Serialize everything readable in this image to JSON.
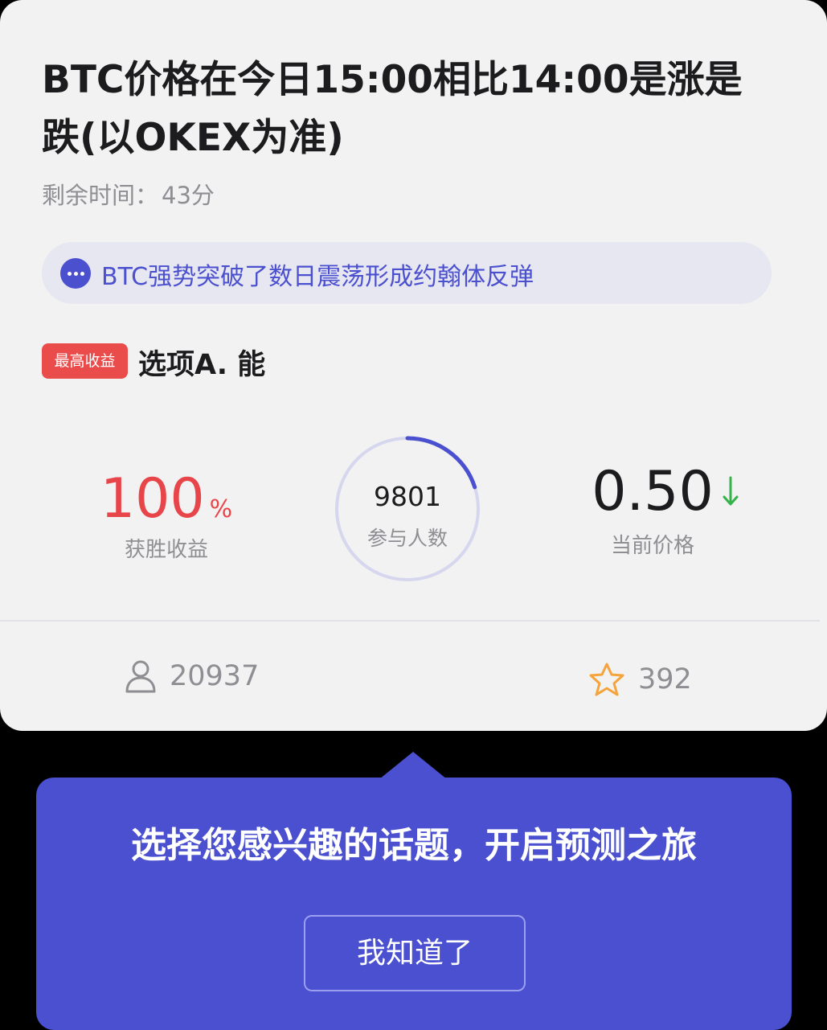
{
  "card": {
    "title": "BTC价格在今日15:00相比14:00是涨是跌(以OKEX为准)",
    "remaining_label": "剩余时间：",
    "remaining_value": "43分",
    "news_text": "BTC强势突破了数日震荡形成约翰体反弹",
    "badge": "最高收益",
    "option": "选项A. 能",
    "payout_value": "100",
    "payout_unit": "%",
    "payout_label": "获胜收益",
    "participants_value": "9801",
    "participants_label": "参与人数",
    "participants_progress": 0.2,
    "price_value": "0.50",
    "price_label": "当前价格",
    "price_trend": "down",
    "users_count": "20937",
    "favorites_count": "392"
  },
  "tooltip": {
    "message": "选择您感兴趣的话题，开启预测之旅",
    "button": "我知道了"
  },
  "colors": {
    "accent": "#4a50cf",
    "red": "#e8454a",
    "green": "#36b24a",
    "star": "#f5a33b"
  }
}
